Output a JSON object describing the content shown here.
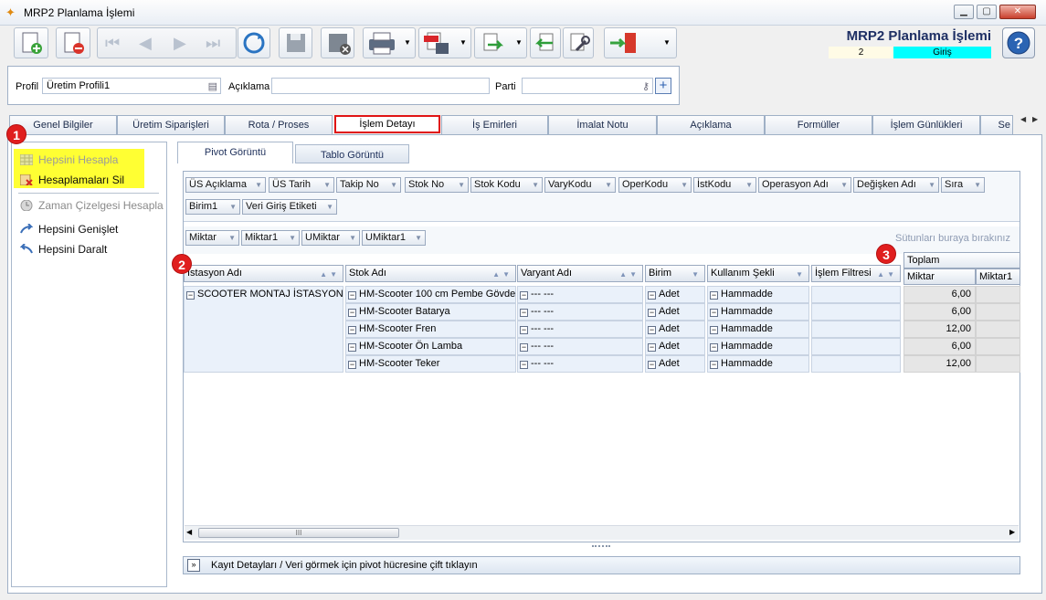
{
  "window": {
    "title": "MRP2 Planlama İşlemi"
  },
  "header": {
    "title": "MRP2 Planlama İşlemi",
    "record_no": "2",
    "mode": "Giriş"
  },
  "filters": {
    "profil_label": "Profil",
    "profil_value": "Üretim Profili1",
    "aciklama_label": "Açıklama",
    "aciklama_value": "",
    "parti_label": "Parti",
    "parti_value": ""
  },
  "tabs": [
    "Genel Bilgiler",
    "Üretim Siparişleri",
    "Rota / Proses",
    "İşlem Detayı",
    "İş Emirleri",
    "İmalat Notu",
    "Açıklama",
    "Formüller",
    "İşlem Günlükleri",
    "Se"
  ],
  "left_nav": {
    "items": [
      "Hepsini Hesapla",
      "Hesaplamaları Sil",
      "Zaman Çizelgesi Hesapla",
      "Hepsini Genişlet",
      "Hepsini Daralt"
    ]
  },
  "view_tabs": [
    "Pivot Görüntü",
    "Tablo Görüntü"
  ],
  "filter_fields_row1": [
    "ÜS Açıklama",
    "ÜS Tarih",
    "Takip No",
    "Stok No",
    "Stok Kodu",
    "VaryKodu",
    "OperKodu",
    "İstKodu",
    "Operasyon Adı",
    "Değişken Adı",
    "Sıra"
  ],
  "filter_fields_row2": [
    "Birim1",
    "Veri Giriş Etiketi"
  ],
  "data_fields": [
    "Miktar",
    "Miktar1",
    "UMiktar",
    "UMiktar1"
  ],
  "drop_hint": "Sütunları buraya bırakınız",
  "row_headers": [
    "İstasyon Adı",
    "Stok Adı",
    "Varyant Adı",
    "Birim",
    "Kullanım Şekli",
    "İşlem Filtresi"
  ],
  "column_group": "Toplam",
  "value_headers": [
    "Miktar",
    "Miktar1"
  ],
  "station": "SCOOTER MONTAJ İSTASYONU",
  "rows": [
    {
      "stok": "HM-Scooter 100 cm Pembe Gövde",
      "varyant": "--- ---",
      "birim": "Adet",
      "kullanim": "Hammadde",
      "miktar": "6,00"
    },
    {
      "stok": "HM-Scooter Batarya",
      "varyant": "--- ---",
      "birim": "Adet",
      "kullanim": "Hammadde",
      "miktar": "6,00"
    },
    {
      "stok": "HM-Scooter Fren",
      "varyant": "--- ---",
      "birim": "Adet",
      "kullanim": "Hammadde",
      "miktar": "12,00"
    },
    {
      "stok": "HM-Scooter Ön Lamba",
      "varyant": "--- ---",
      "birim": "Adet",
      "kullanim": "Hammadde",
      "miktar": "6,00"
    },
    {
      "stok": "HM-Scooter Teker",
      "varyant": "--- ---",
      "birim": "Adet",
      "kullanim": "Hammadde",
      "miktar": "12,00"
    }
  ],
  "footer": "Kayıt Detayları / Veri görmek için pivot hücresine çift tıklayın",
  "badges": [
    "1",
    "2",
    "3"
  ],
  "scroll_grip": "III"
}
